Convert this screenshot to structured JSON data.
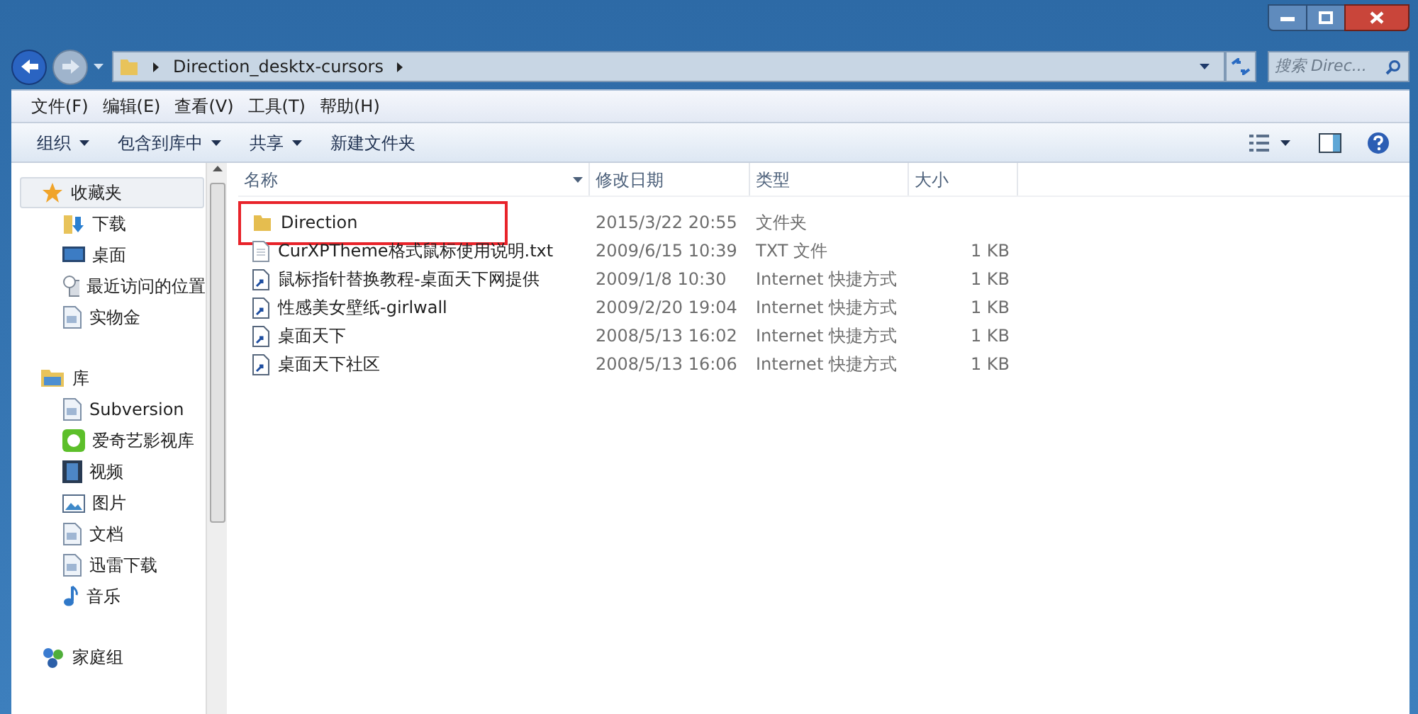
{
  "address_bar": {
    "path": "Direction_desktx-cursors"
  },
  "search": {
    "placeholder": "搜索 Direc..."
  },
  "menu": [
    "文件(F)",
    "编辑(E)",
    "查看(V)",
    "工具(T)",
    "帮助(H)"
  ],
  "toolbar": [
    {
      "label": "组织",
      "dropdown": true
    },
    {
      "label": "包含到库中",
      "dropdown": true
    },
    {
      "label": "共享",
      "dropdown": true
    },
    {
      "label": "新建文件夹",
      "dropdown": false
    }
  ],
  "sidebar": {
    "groups": [
      {
        "label": "收藏夹",
        "kind": "star",
        "selected": true,
        "children": [
          {
            "label": "下载",
            "kind": "download"
          },
          {
            "label": "桌面",
            "kind": "desktop"
          },
          {
            "label": "最近访问的位置",
            "kind": "recent"
          },
          {
            "label": "实物金",
            "kind": "doc"
          }
        ]
      },
      {
        "label": "库",
        "kind": "library",
        "selected": false,
        "children": [
          {
            "label": "Subversion",
            "kind": "doc"
          },
          {
            "label": "爱奇艺影视库",
            "kind": "video-app"
          },
          {
            "label": "视频",
            "kind": "film"
          },
          {
            "label": "图片",
            "kind": "picture"
          },
          {
            "label": "文档",
            "kind": "doc"
          },
          {
            "label": "迅雷下载",
            "kind": "doc"
          },
          {
            "label": "音乐",
            "kind": "music"
          }
        ]
      },
      {
        "label": "家庭组",
        "kind": "homegroup",
        "selected": false
      }
    ]
  },
  "table": {
    "columns": [
      "名称",
      "修改日期",
      "类型",
      "大小"
    ],
    "rows": [
      {
        "kind": "folder",
        "name": "Direction",
        "date": "2015/3/22 20:55",
        "type": "文件夹",
        "highlighted": true
      },
      {
        "kind": "text",
        "name": "CurXPTheme格式鼠标使用说明.txt",
        "date": "2009/6/15 10:39",
        "type": "TXT 文件",
        "size": "1 KB",
        "highlighted": false
      },
      {
        "kind": "shortcut",
        "name": "鼠标指针替换教程-桌面天下网提供",
        "date": "2009/1/8 10:30",
        "type": "Internet 快捷方式",
        "size": "1 KB",
        "highlighted": false
      },
      {
        "kind": "shortcut",
        "name": "性感美女壁纸-girlwall",
        "date": "2009/2/20 19:04",
        "type": "Internet 快捷方式",
        "size": "1 KB",
        "highlighted": false
      },
      {
        "kind": "shortcut",
        "name": "桌面天下",
        "date": "2008/5/13 16:02",
        "type": "Internet 快捷方式",
        "size": "1 KB",
        "highlighted": false
      },
      {
        "kind": "shortcut",
        "name": "桌面天下社区",
        "date": "2008/5/13 16:06",
        "type": "Internet 快捷方式",
        "size": "1 KB",
        "highlighted": false
      }
    ]
  }
}
